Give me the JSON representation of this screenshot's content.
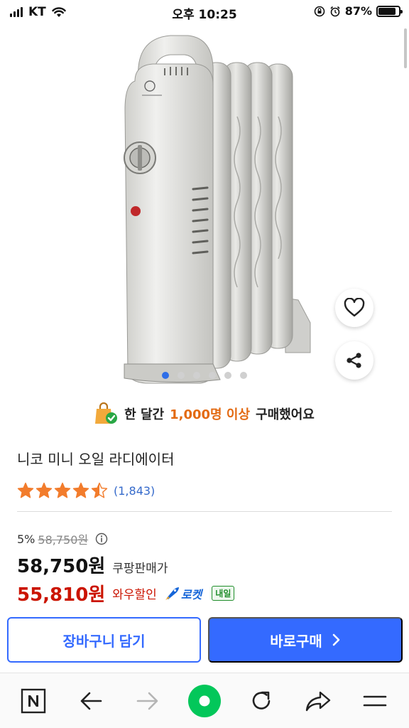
{
  "status_bar": {
    "carrier": "KT",
    "time": "오후 10:25",
    "battery": "87%",
    "battery_level": 0.87
  },
  "product": {
    "image_alt": "니코 미니 오일 라디에이터",
    "carousel_count": 6,
    "carousel_active": 0,
    "purchase_banner_prefix": "한 달간",
    "purchase_banner_highlight": "1,000명 이상",
    "purchase_banner_suffix": "구매했어요",
    "title": "니코 미니 오일 라디에이터",
    "rating": 4.5,
    "rating_max": 5,
    "review_count": "(1,843)"
  },
  "pricing": {
    "discount": "5%",
    "original_price": "58,750원",
    "price": "58,750원",
    "seller_label": "쿠팡판매가",
    "wow_price": "55,810원",
    "wow_label": "와우할인",
    "rocket_label": "로켓",
    "delivery_badge": "내일"
  },
  "actions": {
    "cart": "장바구니 담기",
    "buy": "바로구매"
  },
  "bottom_nav": {
    "icons": [
      "naver-n-icon",
      "back-arrow-icon",
      "forward-arrow-icon",
      "home-circle-icon",
      "refresh-icon",
      "share-arrow-icon",
      "menu-icon"
    ]
  },
  "colors": {
    "accent_blue": "#346aff",
    "sale_red": "#cb1400",
    "star_orange": "#f27c2c",
    "highlight_orange": "#e36a12",
    "naver_green": "#03c75a"
  }
}
